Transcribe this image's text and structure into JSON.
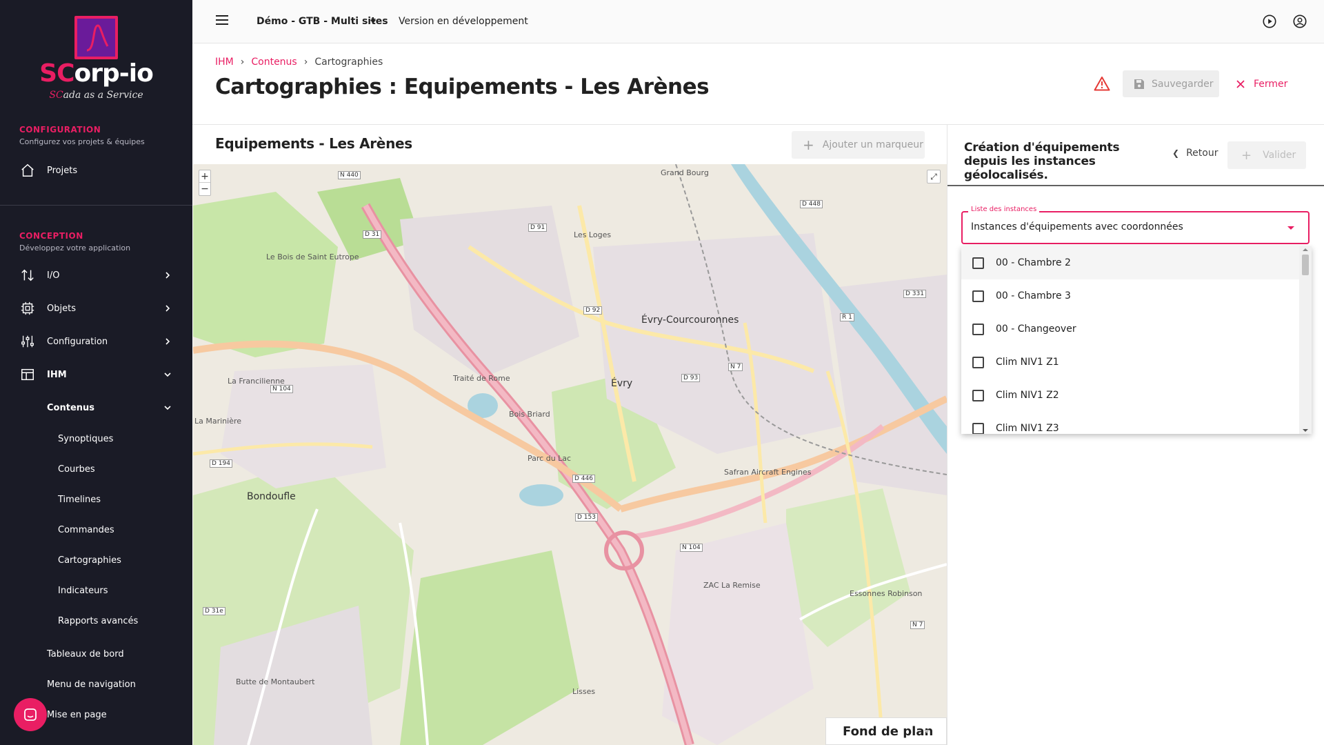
{
  "brand": {
    "name_prefix": "SC",
    "name_suffix": "orp-io",
    "tagline_prefix": "SC",
    "tagline_suffix": "ada as a Service",
    "accent_color": "#e91e63",
    "sidebar_bg": "#1a1b26"
  },
  "sidebar": {
    "configuration": {
      "title": "CONFIGURATION",
      "subtitle": "Configurez vos projets & équipes",
      "items": [
        {
          "label": "Projets",
          "icon": "home-icon"
        }
      ]
    },
    "conception": {
      "title": "CONCEPTION",
      "subtitle": "Développez votre application",
      "items": [
        {
          "label": "I/O",
          "icon": "swap-vert-icon"
        },
        {
          "label": "Objets",
          "icon": "chip-icon"
        },
        {
          "label": "Configuration",
          "icon": "sliders-icon"
        },
        {
          "label": "IHM",
          "icon": "dashboard-icon"
        }
      ],
      "ihm_children": {
        "contenus": "Contenus",
        "contenus_children": [
          "Synoptiques",
          "Courbes",
          "Timelines",
          "Commandes",
          "Cartographies",
          "Indicateurs",
          "Rapports avancés"
        ],
        "others": [
          "Tableaux de bord",
          "Menu de navigation",
          "Mise en page"
        ]
      }
    }
  },
  "topbar": {
    "project": "Démo - GTB - Multi sites",
    "version": "Version en développement"
  },
  "header": {
    "breadcrumb": [
      "IHM",
      "Contenus",
      "Cartographies"
    ],
    "title": "Cartographies : Equipements - Les Arènes",
    "save_label": "Sauvegarder",
    "close_label": "Fermer"
  },
  "map_panel": {
    "title": "Equipements - Les Arènes",
    "add_marker_label": "Ajouter un marqueur",
    "base_layer_label": "Fond de plan",
    "places": {
      "evry_courcouronnes": "Évry-Courcouronnes",
      "evry": "Évry",
      "bondoufle": "Bondoufle",
      "les_loges": "Les Loges",
      "grand_bourg": "Grand Bourg",
      "zac_remise": "ZAC La Remise",
      "lisses": "Lisses",
      "la_mariniere": "La Marinière",
      "bois_briard": "Bois Briard",
      "safran": "Safran Aircraft Engines",
      "le_bois_saint_eutrope": "Le Bois de Saint Eutrope",
      "parc_du_lac": "Parc du Lac",
      "traite_de_rome": "Traité de Rome",
      "butte_montaubert": "Butte de Montaubert",
      "essonnes_robinson": "Essonnes Robinson",
      "la_franciliene": "La Francilienne"
    },
    "roads": {
      "n440": "N 440",
      "d31": "D 31",
      "d91": "D 91",
      "d92": "D 92",
      "n104a": "N 104",
      "d194": "D 194",
      "d446": "D 446",
      "d153": "D 153",
      "n104b": "N 104",
      "d31e": "D 31e",
      "n7": "N 7",
      "d93": "D 93",
      "d448": "D 448",
      "d331": "D 331",
      "n7b": "N 7",
      "r1": "R 1"
    }
  },
  "right_panel": {
    "title": "Création d'équipements depuis les instances géolocalisés.",
    "back_label": "Retour",
    "validate_label": "Valider",
    "select": {
      "label": "Liste des instances",
      "value": "Instances d'équipements avec coordonnées"
    },
    "options": [
      "00 - Chambre 2",
      "00 - Chambre 3",
      "00 - Changeover",
      "Clim NIV1 Z1",
      "Clim NIV1 Z2",
      "Clim NIV1 Z3"
    ]
  }
}
